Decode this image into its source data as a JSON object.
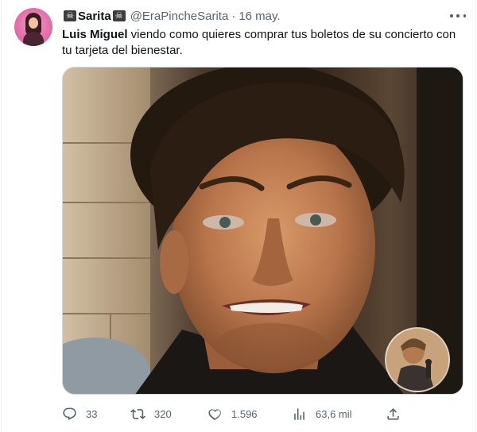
{
  "tweet": {
    "display_name": "Sarita",
    "name_emoji": "skull-and-crossbones",
    "handle": "@EraPincheSarita",
    "separator": "·",
    "date": "16 may.",
    "text_bold": "Luis Miguel",
    "text_rest": " viendo como quieres comprar tus boletos de su concierto con tu tarjeta del bienestar."
  },
  "actions": {
    "replies": "33",
    "retweets": "320",
    "likes": "1.596",
    "views": "63,6 mil"
  },
  "icons": [
    "skull-icon",
    "more-icon",
    "reply-icon",
    "retweet-icon",
    "like-icon",
    "views-icon",
    "share-icon"
  ],
  "colors": {
    "text": "#0f1419",
    "secondary": "#536471",
    "border": "#cfd9de"
  }
}
